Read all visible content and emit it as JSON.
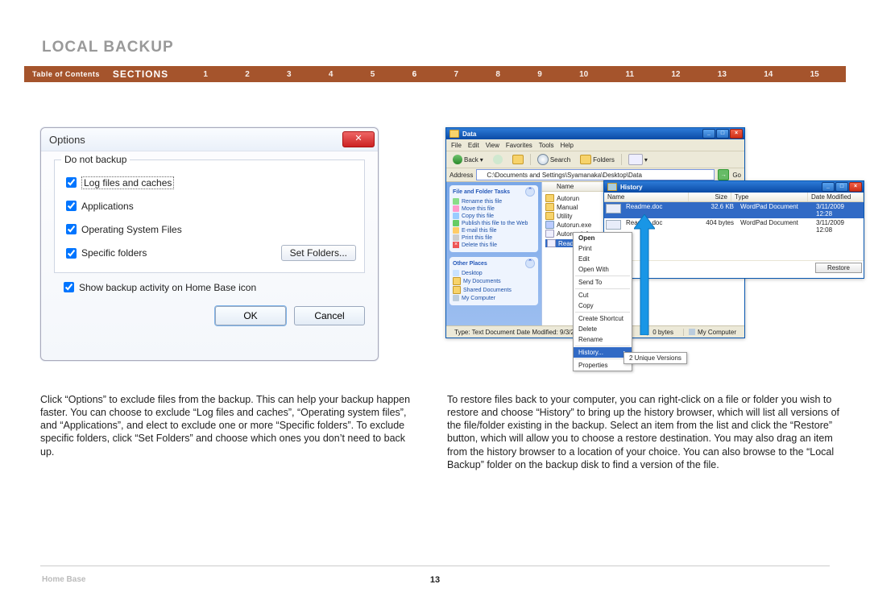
{
  "header": {
    "title": "LOCAL BACKUP",
    "toc_label": "Table of Contents",
    "sections_label": "SECTIONS",
    "sections": [
      "1",
      "2",
      "3",
      "4",
      "5",
      "6",
      "7",
      "8",
      "9",
      "10",
      "11",
      "12",
      "13",
      "14",
      "15"
    ],
    "active_section": "6"
  },
  "options_dialog": {
    "title": "Options",
    "close_glyph": "✕",
    "group_legend": "Do not backup",
    "cb1_label": "Log files and caches",
    "cb2_label": "Applications",
    "cb3_label": "Operating System Files",
    "cb4_label": "Specific folders",
    "set_folders_btn": "Set Folders...",
    "show_activity_label": "Show backup activity on Home Base icon",
    "ok_label": "OK",
    "cancel_label": "Cancel"
  },
  "explorer": {
    "data_window": {
      "title": "Data",
      "menu": [
        "File",
        "Edit",
        "View",
        "Favorites",
        "Tools",
        "Help"
      ],
      "toolbar": {
        "back": "Back",
        "search": "Search",
        "folders": "Folders"
      },
      "address_label": "Address",
      "address_value": "C:\\Documents and Settings\\Syamanaka\\Desktop\\Data",
      "go_label": "Go",
      "tasks_title": "File and Folder Tasks",
      "tasks": {
        "rename": "Rename this file",
        "move": "Move this file",
        "copy": "Copy this file",
        "publish": "Publish this file to the Web",
        "email": "E-mail this file",
        "print": "Print this file",
        "delete": "Delete this file"
      },
      "other_title": "Other Places",
      "other": {
        "desktop": "Desktop",
        "docs": "My Documents",
        "shared": "Shared Documents",
        "computer": "My Computer"
      },
      "files_header": "Name",
      "files": {
        "autorun": "Autorun",
        "manual": "Manual",
        "utility": "Utility",
        "autorun_exe": "Autorun.exe",
        "autorun_inf": "Autorun.inf",
        "readme_txt": "Readme.txt"
      },
      "context": {
        "open": "Open",
        "print": "Print",
        "edit": "Edit",
        "open_with": "Open With",
        "send_to": "Send To",
        "cut": "Cut",
        "copy": "Copy",
        "shortcut": "Create Shortcut",
        "delete": "Delete",
        "rename": "Rename",
        "history": "History...",
        "properties": "Properties",
        "submenu": "2 Unique Versions"
      },
      "status": {
        "type_info": "Type: Text Document Date Modified: 9/3/2008 15:49 S...",
        "size": "0 bytes",
        "location": "My Computer"
      }
    },
    "history_window": {
      "title": "History",
      "cols": {
        "name": "Name",
        "size": "Size",
        "type": "Type",
        "date": "Date Modified"
      },
      "rows": [
        {
          "name": "Readme.doc",
          "size": "32.6 KB",
          "type": "WordPad Document",
          "date": "3/11/2009 12:28"
        },
        {
          "name": "Readme.doc",
          "size": "404 bytes",
          "type": "WordPad Document",
          "date": "3/11/2009 12:08"
        }
      ],
      "restore_label": "Restore"
    }
  },
  "paragraphs": {
    "left": "Click “Options” to exclude files from the backup. This can help your backup happen faster. You can choose to exclude “Log files and caches”, “Operating system files”, and “Applications”, and elect to exclude one or more “Specific folders”. To exclude specific folders, click “Set Folders” and choose which ones you don’t need to back up.",
    "right": "To restore files back to your computer, you can right-click on a file or folder you wish to restore and choose “History” to bring up the history browser, which will list all versions of the file/folder existing in the backup. Select an item from the list and click the “Restore” button, which will allow you to choose a restore destination. You may also drag an item from the history browser to a location of your choice. You can also browse to the “Local Backup” folder on the backup disk to find a version of the file."
  },
  "footer": {
    "left": "Home Base",
    "page": "13"
  }
}
